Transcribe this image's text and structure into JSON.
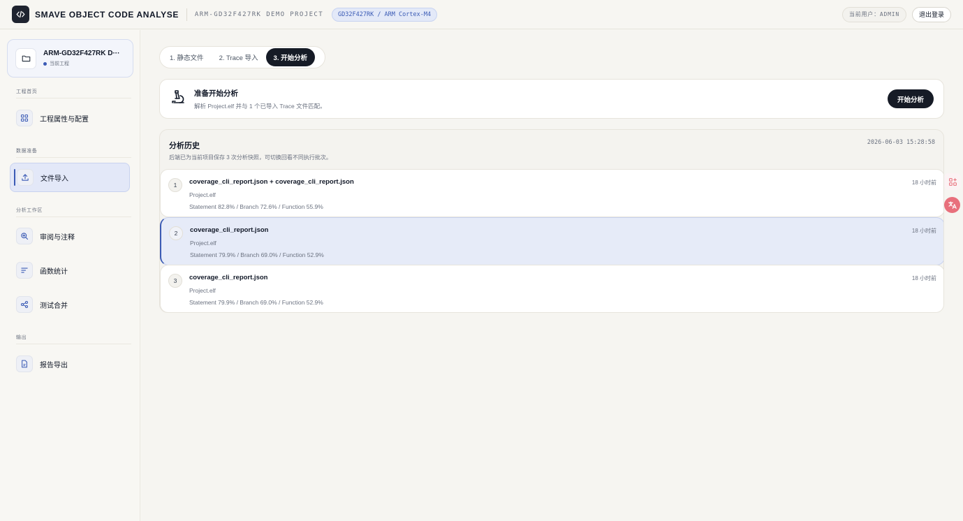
{
  "header": {
    "brand": "SMAVE OBJECT CODE ANALYSE",
    "project_name": "ARM-GD32F427RK DEMO PROJECT",
    "chip": "GD32F427RK / ARM Cortex-M4",
    "current_user": "当前用户：ADMIN",
    "logout": "退出登录"
  },
  "sidebar": {
    "project_card": {
      "title": "ARM-GD32F427RK D···",
      "subtitle": "当前工程"
    },
    "sections": [
      {
        "label": "工程首页",
        "items": [
          {
            "label": "工程属性与配置",
            "icon": "grid-icon"
          }
        ]
      },
      {
        "label": "数据准备",
        "items": [
          {
            "label": "文件导入",
            "icon": "upload-icon",
            "active": true
          }
        ]
      },
      {
        "label": "分析工作区",
        "items": [
          {
            "label": "审阅与注释",
            "icon": "zoom-icon"
          },
          {
            "label": "函数统计",
            "icon": "list-icon"
          },
          {
            "label": "测试合并",
            "icon": "share-icon"
          }
        ]
      },
      {
        "label": "输出",
        "items": [
          {
            "label": "报告导出",
            "icon": "document-icon"
          }
        ]
      }
    ]
  },
  "tabs": [
    {
      "label": "1. 静态文件"
    },
    {
      "label": "2. Trace 导入"
    },
    {
      "label": "3. 开始分析",
      "active": true
    }
  ],
  "ready": {
    "title": "准备开始分析",
    "subtitle": "解析 Project.elf 并与 1 个已导入 Trace 文件匹配。",
    "button": "开始分析",
    "icon": "microscope-icon"
  },
  "history": {
    "title": "分析历史",
    "subtitle": "后端已为当前项目保存 3 次分析快照，可切换回看不同执行批次。",
    "timestamp": "2026-06-03 15:28:58",
    "rows": [
      {
        "num": "1",
        "title": "coverage_cli_report.json + coverage_cli_report.json",
        "file": "Project.elf",
        "metrics": "Statement 82.8% / Branch 72.6% / Function 55.9%",
        "age": "18 小时前"
      },
      {
        "num": "2",
        "title": "coverage_cli_report.json",
        "file": "Project.elf",
        "metrics": "Statement 79.9% / Branch 69.0% / Function 52.9%",
        "age": "18 小时前",
        "selected": true
      },
      {
        "num": "3",
        "title": "coverage_cli_report.json",
        "file": "Project.elf",
        "metrics": "Statement 79.9% / Branch 69.0% / Function 52.9%",
        "age": "18 小时前"
      }
    ]
  },
  "floating": {
    "widget_a_icon": "apps-icon",
    "widget_b_icon": "translate-icon",
    "widget_b_color": "#e8707c"
  },
  "colors": {
    "accent": "#3b5bb5",
    "dark": "#161b26",
    "background": "#f6f5f1"
  }
}
